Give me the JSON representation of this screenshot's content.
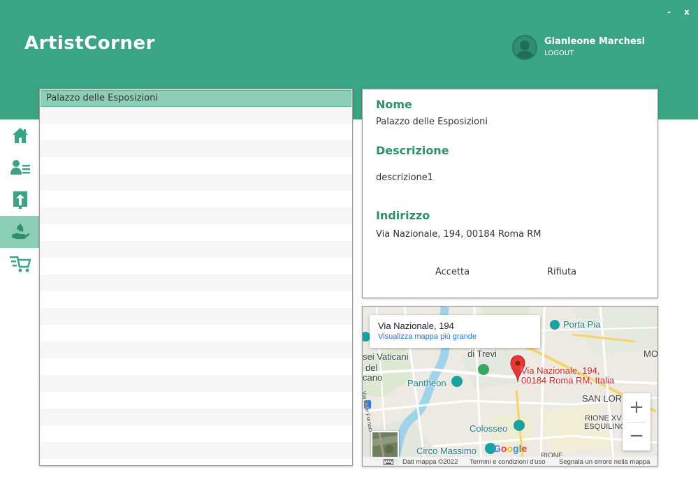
{
  "app": {
    "title": "ArtistCorner",
    "window_controls": {
      "minimize": "-",
      "close": "x"
    }
  },
  "user": {
    "name": "Gianleone Marchesi",
    "logout_label": "LOGOUT"
  },
  "sidebar": {
    "items": [
      {
        "icon": "home-icon",
        "active": false
      },
      {
        "icon": "user-list-icon",
        "active": false
      },
      {
        "icon": "upload-icon",
        "active": false
      },
      {
        "icon": "hand-flame-icon",
        "active": true
      },
      {
        "icon": "cart-icon",
        "active": false
      }
    ]
  },
  "list": {
    "items": [
      {
        "label": "Palazzo delle Esposizioni",
        "selected": true
      }
    ]
  },
  "details": {
    "name_label": "Nome",
    "name_value": "Palazzo delle Esposizioni",
    "description_label": "Descrizione",
    "description_value": "descrizione1",
    "address_label": "Indirizzo",
    "address_value": "Via Nazionale, 194, 00184 Roma RM",
    "accept_label": "Accetta",
    "reject_label": "Rifiuta"
  },
  "map": {
    "info_title": "Via Nazionale, 194",
    "info_link": "Visualizza mappa più grande",
    "marker_label_line1": "Via Nazionale, 194,",
    "marker_label_line2": "00184 Roma RM, Italia",
    "places": {
      "porta_pia": "Porta Pia",
      "vaticani": "sei Vaticani",
      "del": "del",
      "cano": "cano",
      "trevi": "di Trevi",
      "pantheon": "Pantheon",
      "mo": "MO",
      "san_lor": "SAN LOR",
      "rione": "RIONE XV",
      "esquilino": "ESQUILINO",
      "colosseo": "Colosseo",
      "circo_massimo": "Circo Massimo",
      "via_fornaci": "Via delle Fornaci",
      "via_small": "Via delle",
      "rione_bottom": "RIONE"
    },
    "zoom_in": "+",
    "zoom_out": "−",
    "google": "Google",
    "footer": {
      "data": "Dati mappa ©2022",
      "terms": "Termini e condizioni d'uso",
      "report": "Segnala un errore nella mappa"
    }
  },
  "colors": {
    "accent": "#3aa583",
    "accent_light": "#8ccfb6",
    "label": "#2e8f6d"
  }
}
